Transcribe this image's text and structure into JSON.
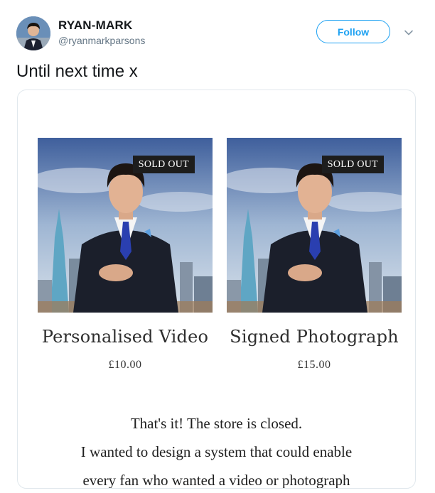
{
  "tweet": {
    "author": {
      "display_name": "RYAN-MARK",
      "handle": "@ryanmarkparsons"
    },
    "follow_label": "Follow",
    "text": "Until next time x"
  },
  "card": {
    "products": [
      {
        "title": "Personalised Video",
        "price": "£10.00",
        "badge": "SOLD OUT"
      },
      {
        "title": "Signed Photograph",
        "price": "£15.00",
        "badge": "SOLD OUT"
      }
    ],
    "body_lines": [
      "That's it! The store is closed.",
      "I wanted to design a system that could enable",
      "every fan who wanted a video or photograph"
    ]
  },
  "colors": {
    "accent": "#1da1f2",
    "text": "#14171a",
    "muted": "#657786",
    "border": "#e1e8ed",
    "badge_bg": "#1d1d1d"
  },
  "icons": {
    "caret": "chevron-down-icon"
  }
}
